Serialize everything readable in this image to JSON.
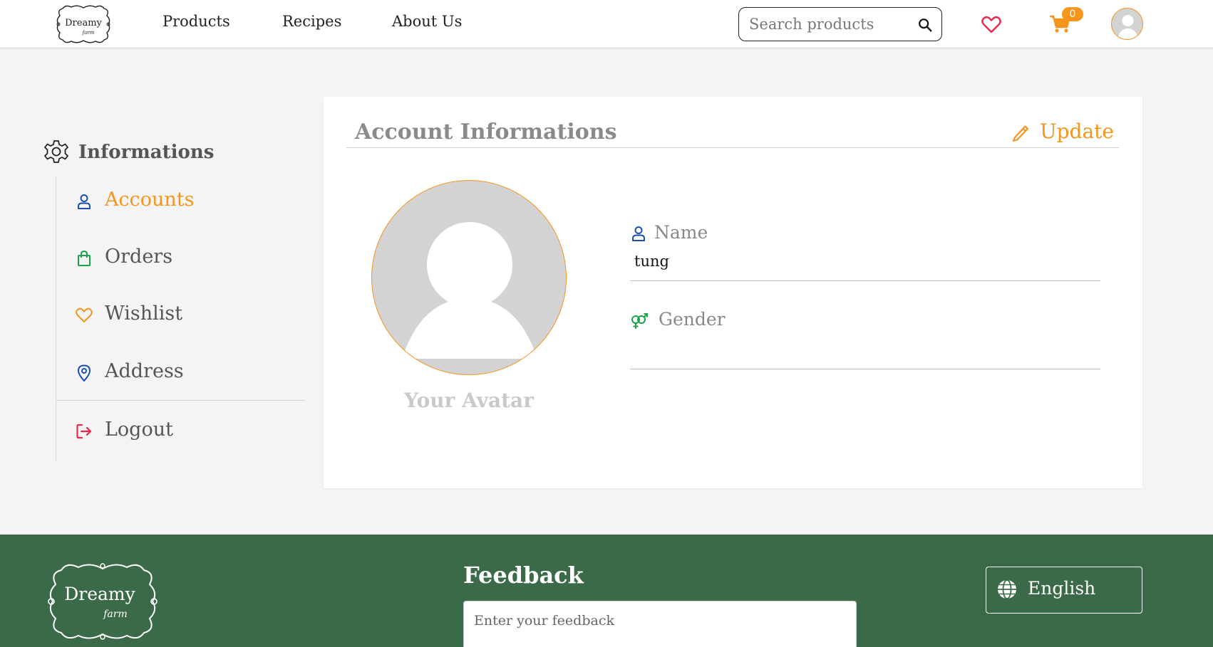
{
  "brand": {
    "logo_main": "Dreamy",
    "logo_sub": "farm"
  },
  "nav": {
    "items": [
      {
        "label": "Products"
      },
      {
        "label": "Recipes"
      },
      {
        "label": "About Us"
      }
    ],
    "search_placeholder": "Search products",
    "cart_count": "0"
  },
  "sidebar": {
    "title": "Informations",
    "items": [
      {
        "label": "Accounts",
        "icon": "user-icon",
        "color": "#1a4fb0"
      },
      {
        "label": "Orders",
        "icon": "shopping-bag-icon",
        "color": "#1aa34a"
      },
      {
        "label": "Wishlist",
        "icon": "heart-icon",
        "color": "#f7941d"
      },
      {
        "label": "Address",
        "icon": "map-pin-icon",
        "color": "#1a4fb0"
      },
      {
        "label": "Logout",
        "icon": "logout-icon",
        "color": "#e8294b"
      }
    ]
  },
  "account": {
    "title": "Account Informations",
    "update_label": "Update",
    "avatar_caption": "Your Avatar",
    "name_label": "Name",
    "name_value": "tung",
    "gender_label": "Gender",
    "gender_value": ""
  },
  "footer": {
    "feedback_title": "Feedback",
    "feedback_placeholder": "Enter your feedback",
    "language": "English"
  },
  "colors": {
    "accent": "#f7941d",
    "footer_bg": "#3b6a48",
    "wishlist_heart": "#e8294b"
  }
}
